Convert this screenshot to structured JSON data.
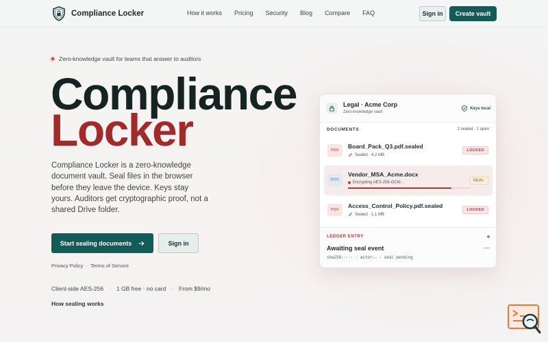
{
  "nav": {
    "brand": "Compliance Locker",
    "links": [
      "How it works",
      "Pricing",
      "Security",
      "Blog",
      "Compare",
      "FAQ"
    ],
    "sign_in": "Sign in",
    "create_vault": "Create vault"
  },
  "hero": {
    "eyebrow": "Zero-knowledge vault for teams that answer to auditors",
    "title_line1": "Compliance",
    "title_line2": "Locker",
    "lede": "Compliance Locker is a zero-knowledge document vault. Seal files in the browser before they leave the device. Keys stay yours. Auditors get cryptographic proof, not a shared Drive folder.",
    "cta_primary": "Start sealing documents",
    "cta_secondary": "Sign in",
    "legal": {
      "privacy": "Privacy Policy",
      "sep": "·",
      "terms": "Terms of Service"
    },
    "facts": [
      "Client-side AES-256",
      "1 GB free · no card",
      "From $9/mo"
    ],
    "fact_sep": "·",
    "how_link": "How sealing works"
  },
  "vault": {
    "title": "Legal · Acme Corp",
    "subtitle": "Zero-knowledge vault",
    "keys": "Keys local",
    "docs_label": "DOCUMENTS",
    "docs_count": "2 sealed · 1 open",
    "documents": [
      {
        "type": "PDF",
        "name": "Board_Pack_Q3.pdf.sealed",
        "meta": "Sealed · 4.2 MB",
        "status": "LOCKED"
      },
      {
        "type": "DOC",
        "name": "Vendor_MSA_Acme.docx",
        "meta": "Encrypting AES-256-GCM…",
        "status": "SEAL",
        "progress": 0.85
      },
      {
        "type": "PDF",
        "name": "Access_Control_Policy.pdf.sealed",
        "meta": "Sealed · 1.1 MB",
        "status": "LOCKED"
      }
    ],
    "ledger": {
      "label": "LEDGER ENTRY",
      "title": "Awaiting seal event",
      "dash": "—",
      "hash": "sha256:···· · actor:— · seal pending"
    }
  },
  "colors": {
    "primary": "#125b58",
    "accent": "#a12b2b",
    "locked": "#b03a3a",
    "seal": "#b77a2a"
  },
  "icons": {
    "brand": "shield-lock-icon",
    "cta_arrow": "arrow-right-icon",
    "vault": "lock-icon",
    "keys": "shield-check-icon",
    "sealed_meta": "link-icon",
    "widget": "chat-search-icon"
  }
}
